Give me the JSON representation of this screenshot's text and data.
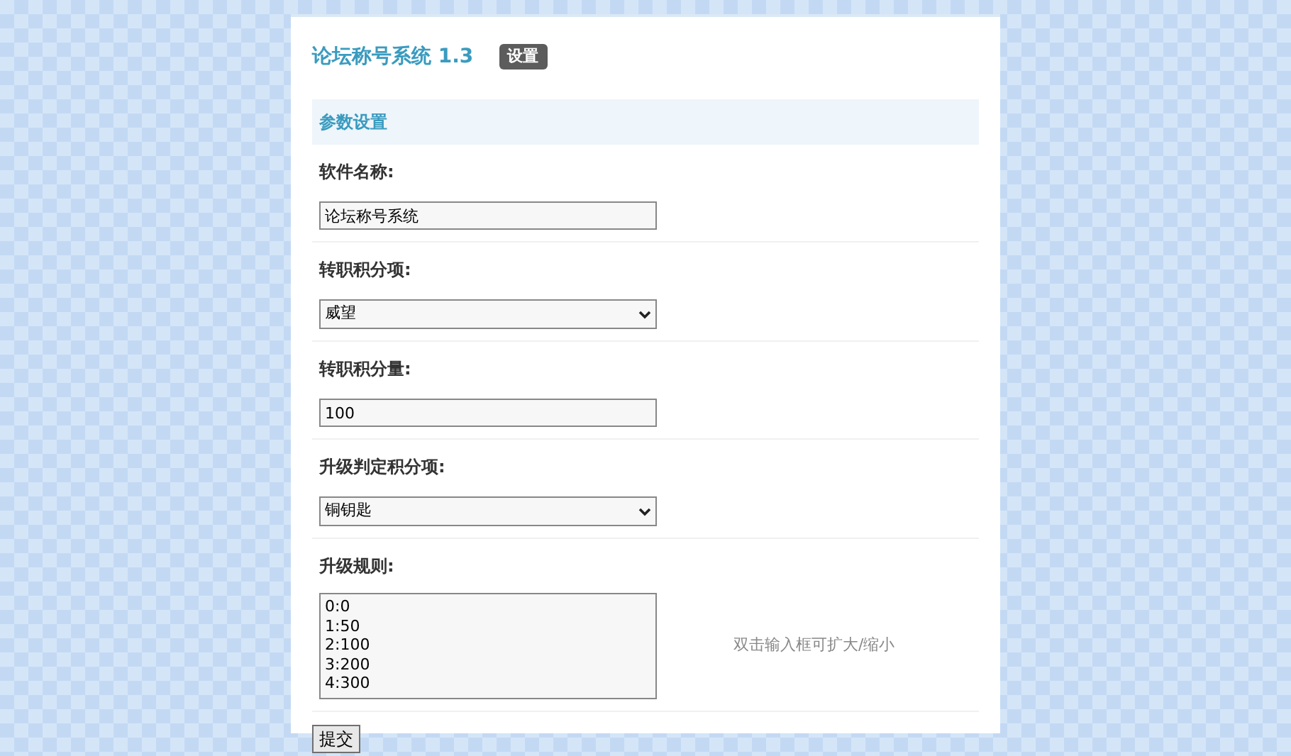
{
  "header": {
    "title": "论坛称号系统 1.3",
    "badge": "设置"
  },
  "section": {
    "title": "参数设置"
  },
  "fields": [
    {
      "kind": "text",
      "label": "软件名称:",
      "value": "论坛称号系统"
    },
    {
      "kind": "select",
      "label": "转职积分项:",
      "value": "威望"
    },
    {
      "kind": "text",
      "label": "转职积分量:",
      "value": "100"
    },
    {
      "kind": "select",
      "label": "升级判定积分项:",
      "value": "铜钥匙"
    },
    {
      "kind": "textarea",
      "label": "升级规则:",
      "value": "0:0\n1:50\n2:100\n3:200\n4:300",
      "hint": "双击输入框可扩大/缩小"
    }
  ],
  "submit": "提交"
}
